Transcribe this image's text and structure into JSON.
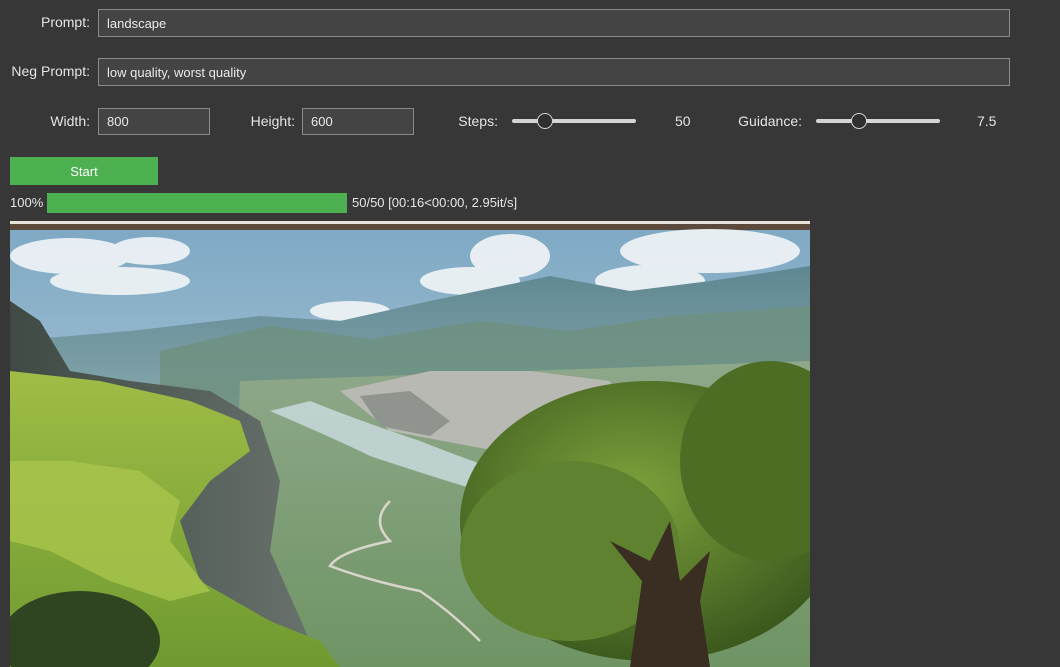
{
  "form": {
    "prompt_label": "Prompt:",
    "prompt_value": "landscape",
    "neg_prompt_label": "Neg Prompt:",
    "neg_prompt_value": "low quality, worst quality",
    "width_label": "Width:",
    "width_value": "800",
    "height_label": "Height:",
    "height_value": "600",
    "steps_label": "Steps:",
    "steps_value": "50",
    "steps_level": 0.27,
    "guidance_label": "Guidance:",
    "guidance_value": "7.5",
    "guidance_level": 0.35
  },
  "actions": {
    "start_label": "Start"
  },
  "progress": {
    "percent_text": "100%",
    "fraction": 1.0,
    "status_text": "50/50 [00:16<00:00, 2.95it/s]"
  },
  "colors": {
    "accent": "#4caf50",
    "background": "#373737",
    "field_bg": "#444444"
  }
}
